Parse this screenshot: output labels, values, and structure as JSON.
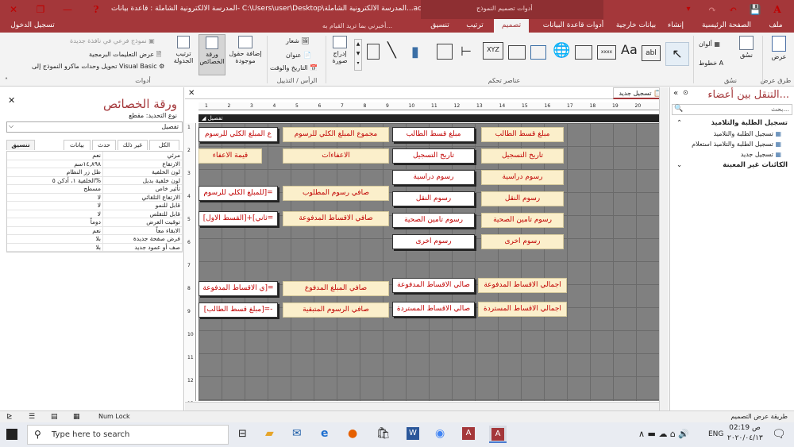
{
  "title": {
    "document": "المدرسة الالكترونية الشاملة : قاعدة بيانات- C:\\Users\\user\\Desktop\\المدرسة الالكترونية الشاملة...accd...",
    "context_tool": "أدوات تصميم النموذج",
    "sign_in": "تسجيل الدخول",
    "help_glyph": "?"
  },
  "ribbon_tabs": [
    {
      "label": "ملف"
    },
    {
      "label": "الصفحة الرئيسية"
    },
    {
      "label": "إنشاء"
    },
    {
      "label": "بيانات خارجية"
    },
    {
      "label": "أدوات قاعدة البيانات"
    },
    {
      "label": "تصميم"
    },
    {
      "label": "ترتيب"
    },
    {
      "label": "تنسيق"
    },
    {
      "label": "أخبرني بما تريد القيام به..."
    }
  ],
  "ribbon": {
    "views": {
      "view": "عرض",
      "group": "طرق عرض"
    },
    "themes": {
      "themes": "نسُق",
      "colors": "ألوان",
      "fonts": "خطوط",
      "group": "نسُق"
    },
    "controls": {
      "group": "عناصر تحكم",
      "insert_image": "إدراج صورة",
      "textbox_glyph": "abl",
      "label_glyph": "Aa",
      "xyz": "XYZ",
      "xxxx": "xxxx"
    },
    "header_footer": {
      "logo": "شعار",
      "title": "عنوان",
      "datetime": "التاريخ والوقت",
      "group": "الرأس / التذييل"
    },
    "tools": {
      "add_fields": "إضافة حقول موجودة",
      "property_sheet": "ورقة الخصائص",
      "tab_order": "ترتيب الجدولة",
      "subform": "نموذج فرعي في نافذة جديدة",
      "view_code": "عرض التعليمات البرمجية",
      "convert_macros": "تحويل وحدات ماكرو النموذج إلى Visual Basic",
      "group": "أدوات"
    }
  },
  "property_sheet": {
    "title": "ورقة الخصائص",
    "selection_type": "نوع التحديد: مقطع",
    "selected": "تفصيل",
    "tabs": [
      "الكل",
      "غير ذلك",
      "حدث",
      "بيانات",
      "تنسيق"
    ],
    "rows": [
      {
        "name": "مرئي",
        "value": "نعم"
      },
      {
        "name": "الارتفاع",
        "value": "١٤,٨٩٨سم"
      },
      {
        "name": "لون الخلفية",
        "value": "ظل زر النظام"
      },
      {
        "name": "لون خلفية بديل",
        "value": "الخلفية ١، أدكن ٥%"
      },
      {
        "name": "تأثير خاص",
        "value": "مسطح"
      },
      {
        "name": "الارتفاع التلقائي",
        "value": "لا"
      },
      {
        "name": "قابل للنمو",
        "value": "لا"
      },
      {
        "name": "قابل للتقلص",
        "value": "لا"
      },
      {
        "name": "توقيت العرض",
        "value": "دوماً"
      },
      {
        "name": "الابقاء معاً",
        "value": "نعم"
      },
      {
        "name": "فرض صفحة جديدة",
        "value": "بلا"
      },
      {
        "name": "صف أو عمود جديد",
        "value": "بلا"
      }
    ]
  },
  "designer": {
    "tab": "تسجيل جديد",
    "section": "تفصيل",
    "ruler_numbers": [
      "1",
      "2",
      "3",
      "4",
      "5",
      "6",
      "7",
      "8",
      "9",
      "10",
      "11",
      "12",
      "13",
      "14",
      "15",
      "16",
      "17",
      "18",
      "19",
      "20"
    ],
    "vruler_numbers": [
      "1",
      "2",
      "3",
      "4",
      "5",
      "6",
      "7",
      "8",
      "9",
      "10",
      "11",
      "12",
      "13"
    ],
    "labels": [
      "مبلغ قسط الطالب",
      "تاريخ التسجيل",
      "رسوم دراسية",
      "رسوم النقل",
      "رسوم تامين الصحية",
      "رسوم اخرى",
      "مجموع المبلغ الكلي للرسوم",
      "الاعفاءات",
      "صافي رسوم المطلوب",
      "صافي الاقساط المدفوعة",
      "اجمالي الاقساط المدفوعة",
      "اجمالي الاقساط المستردة",
      "صافي المبلغ المدفوع",
      "صافي الرسوم المتبقية",
      "قيمة الاعفاء"
    ],
    "textboxes": [
      "مبلغ قسط الطالب",
      "تاريخ التسجيل",
      "رسوم دراسية",
      "رسوم النقل",
      "رسوم تامين الصحية",
      "رسوم اخرى",
      "ع المبلغ الكلي للرسوم",
      "للمبلغ الكلي للرسوم]=",
      "ثاني]+[القسط الاول]=",
      "صالي الاقساط المدفوعة",
      "صالي الاقساط المستردة",
      "ي الاقساط المدفوعة]=",
      "[مبلغ قسط الطالب]=-"
    ]
  },
  "nav_pane": {
    "title": "التنقل بين أعضاء...",
    "search_placeholder": "بحث...",
    "groups": [
      {
        "name": "تسجيل الطلبة والتلاميذ",
        "items": [
          "تسجيل الطلبة والتلاميذ",
          "تسجيل الطلبة والتلاميذ استعلام",
          "تسجيل جديد"
        ]
      },
      {
        "name": "الكائنات غير المعينة",
        "items": []
      }
    ]
  },
  "status": {
    "left": "طريقة عرض التصميم",
    "numlock": "Num Lock"
  },
  "taskbar": {
    "search_placeholder": "Type here to search",
    "time": "02:19 ص",
    "date": "٢٠٢٠/٠٤/١٣",
    "lang": "ENG"
  }
}
